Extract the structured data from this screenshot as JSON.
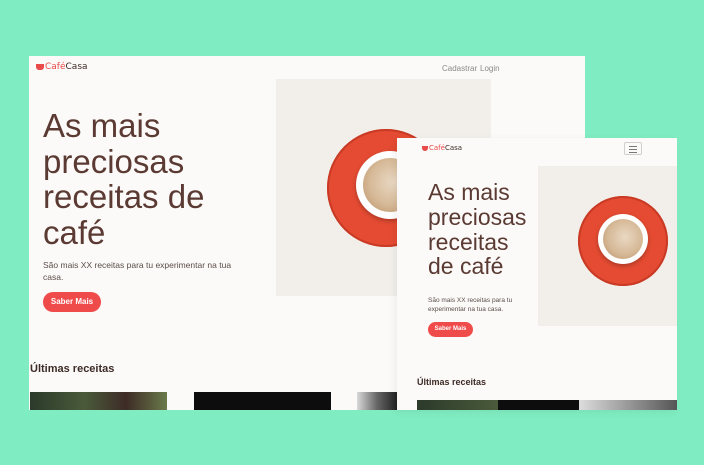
{
  "site": {
    "brand_part1": "Café",
    "brand_part2": "Casa",
    "nav": {
      "signup": "Cadastrar",
      "login": "Login"
    }
  },
  "hero": {
    "title_lines_desktop": [
      "As mais",
      "preciosas",
      "receitas de",
      "café"
    ],
    "title_lines_mobile": [
      "As mais",
      "preciosas",
      "receitas",
      "de café"
    ],
    "subtitle": "São mais XX receitas para tu experimentar na tua casa.",
    "button": "Saber Mais"
  },
  "recipes": {
    "title": "Últimas receitas"
  },
  "icons": {
    "brand": "coffee-cup-icon",
    "menu": "hamburger-menu-icon"
  },
  "colors": {
    "background": "#80ecc1",
    "accent": "#f04b4b",
    "title": "#5a3a33",
    "page": "#fcfaf8"
  }
}
